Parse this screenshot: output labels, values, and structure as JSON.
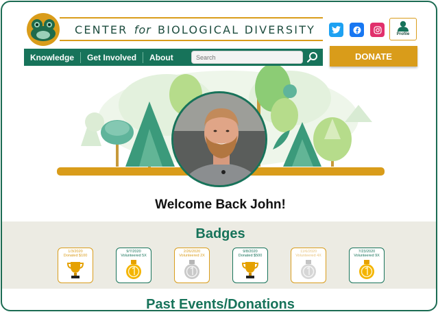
{
  "brand": {
    "title_pre": "CENTER",
    "title_for": "for",
    "title_post": "BIOLOGICAL DIVERSITY",
    "accent_color": "#d99c1a",
    "primary_color": "#17735a"
  },
  "nav": {
    "items": [
      "Knowledge",
      "Get Involved",
      "About"
    ],
    "search_placeholder": "Search"
  },
  "social": [
    "twitter-icon",
    "facebook-icon",
    "instagram-icon"
  ],
  "profile": {
    "label": "Profile"
  },
  "donate": {
    "label": "DONATE"
  },
  "welcome": {
    "text": "Welcome Back John!"
  },
  "badges": {
    "title": "Badges",
    "items": [
      {
        "date": "1/3/2020",
        "text": "Donated $100",
        "icon": "trophy-gold",
        "color": "gold"
      },
      {
        "date": "9/7/2020",
        "text": "Volunteered 5X",
        "icon": "medal-gold",
        "color": "green"
      },
      {
        "date": "2/26/2020",
        "text": "Volunteered 2X",
        "icon": "medal-silver",
        "color": "gold"
      },
      {
        "date": "9/8/2020",
        "text": "Donated $500",
        "icon": "trophy-gold",
        "color": "green"
      },
      {
        "date": "11/6/2020",
        "text": "Volunteered 4X",
        "icon": "medal-silver",
        "color": "gold"
      },
      {
        "date": "7/23/2020",
        "text": "Volunteered 9X",
        "icon": "medal-gold",
        "color": "green"
      }
    ]
  },
  "events": {
    "title": "Past Events/Donations"
  }
}
